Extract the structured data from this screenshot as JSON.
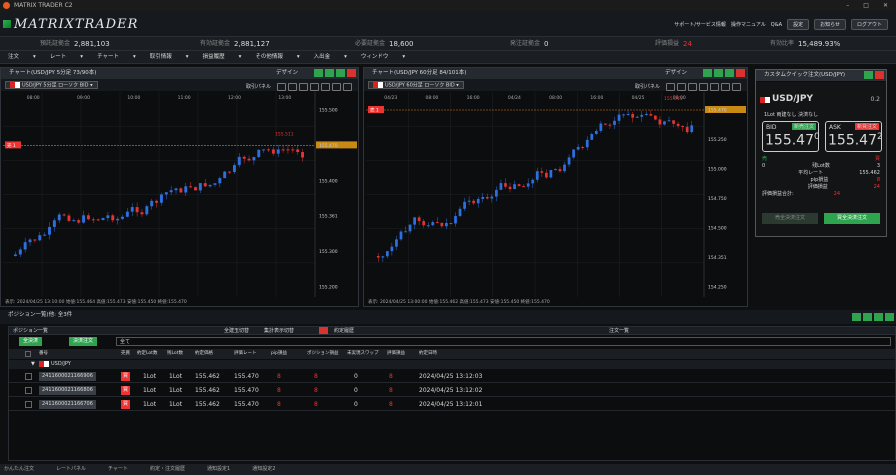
{
  "app": {
    "title": "MATRIX TRADER C2",
    "brand": "MATRIXTRADER"
  },
  "header": {
    "links": [
      "サポート/サービス情報",
      "操作マニュアル",
      "Q&A"
    ],
    "btn_settings": "設定",
    "btn_notice": "お知らせ",
    "btn_logout": "ログアウト",
    "badge": "24"
  },
  "account": [
    {
      "label": "預託証拠金",
      "value": "2,881,103"
    },
    {
      "label": "有効証拠金",
      "value": "2,881,127"
    },
    {
      "label": "必要証拠金",
      "value": "18,600"
    },
    {
      "label": "発注証拠金",
      "value": "0"
    },
    {
      "label": "評価損益",
      "value": "24"
    },
    {
      "label": "有効比率",
      "value": "15,489.93%"
    }
  ],
  "menu": [
    "注文",
    "レート",
    "チャート",
    "取引情報",
    "損益履歴",
    "その他情報",
    "入出金",
    "ウィンドウ"
  ],
  "chart1": {
    "title": "チャート(USD/JPY 5分足 73/90本)",
    "symbol": "USD/JPY 5分足 ローソク BID",
    "panel_label": "取引パネル",
    "design": "デザイン",
    "times": [
      "08:00",
      "09:00",
      "10:00",
      "11:00",
      "12:00",
      "13:00"
    ],
    "price_labels": [
      "155.500",
      "155.470",
      "155.400",
      "155.361",
      "155.300",
      "155.200"
    ],
    "high_label": "155.511",
    "line_label": "売 1",
    "footer": "表示: 2024/04/25 13:10:00 始値:155.464 高値:155.473 安値:155.450 終値:155.470"
  },
  "chart2": {
    "title": "チャート(USD/JPY 60分足 84/101本)",
    "symbol": "USD/JPY 60分足 ローソク BID",
    "panel_label": "取引パネル",
    "design": "デザイン",
    "times": [
      "04/23",
      "08:00",
      "16:00",
      "04/24",
      "08:00",
      "16:00",
      "04/25",
      "08:00"
    ],
    "price_labels": [
      "155.470",
      "155.250",
      "155.000",
      "154.750",
      "154.500",
      "154.351",
      "154.250"
    ],
    "high_label": "155.511",
    "mid_label": "154.472",
    "low_label": "154.351",
    "line_label": "売 1",
    "footer": "表示: 2024/04/25 13:00:00 始値:155.462 高値:155.473 安値:155.450 終値:155.470"
  },
  "quick": {
    "title": "カスタムクイック注文(USD/JPY)",
    "symbol": "USD/JPY",
    "lot": "0.2",
    "position_text": "1Lot 両建なし 決済なし",
    "bid_label": "BID",
    "bid_tag": "新売注文",
    "bid_price": "155.47",
    "bid_sup": "0",
    "ask_label": "ASK",
    "ask_tag": "新買注文",
    "ask_price": "155.47",
    "ask_sup": "2",
    "sell_head": "売",
    "buy_head": "買",
    "sell_count": "0",
    "buy_count": "3",
    "stats": [
      {
        "label": "残Lot数",
        "value": "3"
      },
      {
        "label": "平均レート",
        "value": "155.462"
      },
      {
        "label": "pip損益",
        "value": "8"
      },
      {
        "label": "評価損益",
        "value": "24"
      }
    ],
    "total_label": "評価損益合計:",
    "total_value": "24",
    "btn_sell_close": "売全決済注文",
    "btn_buy_close": "買全決済注文"
  },
  "positions": {
    "title": "ポジション一覧(他: 全3件",
    "sub_left": "ポジション一覧",
    "toggle1": "全建玉切替",
    "toggle2": "集計表示切替",
    "tab_order": "約定履歴",
    "tab_order2": "注文一覧",
    "btn_all_close": "全決済",
    "btn_close_order": "決済注文",
    "filter": "全て",
    "columns": [
      "番号",
      "売買",
      "約定Lot数",
      "残Lot数",
      "約定価格",
      "評価レート",
      "pip損益",
      "ポジション損益",
      "未実現スワップ",
      "評価損益",
      "約定日時"
    ],
    "group": "USD/JPY",
    "rows": [
      {
        "no": "2411600021166906",
        "side": "買",
        "lot": "1Lot",
        "rem": "1Lot",
        "price": "155.462",
        "rate": "155.470",
        "pip": "8",
        "pl": "8",
        "swap": "0",
        "eval": "8",
        "date": "2024/04/25 13:12:03"
      },
      {
        "no": "2411600021166806",
        "side": "買",
        "lot": "1Lot",
        "rem": "1Lot",
        "price": "155.462",
        "rate": "155.470",
        "pip": "8",
        "pl": "8",
        "swap": "0",
        "eval": "8",
        "date": "2024/04/25 13:12:02"
      },
      {
        "no": "2411600021166706",
        "side": "買",
        "lot": "1Lot",
        "rem": "1Lot",
        "price": "155.462",
        "rate": "155.470",
        "pip": "8",
        "pl": "8",
        "swap": "0",
        "eval": "8",
        "date": "2024/04/25 13:12:01"
      }
    ]
  },
  "bottom_tabs": [
    "かんたん注文",
    "レートパネル",
    "チャート",
    "約定・注文履歴",
    "通知設定1",
    "通知設定2"
  ],
  "colors": {
    "up": "#2e6fe0",
    "down": "#e33333",
    "accent": "#2ea44f"
  }
}
